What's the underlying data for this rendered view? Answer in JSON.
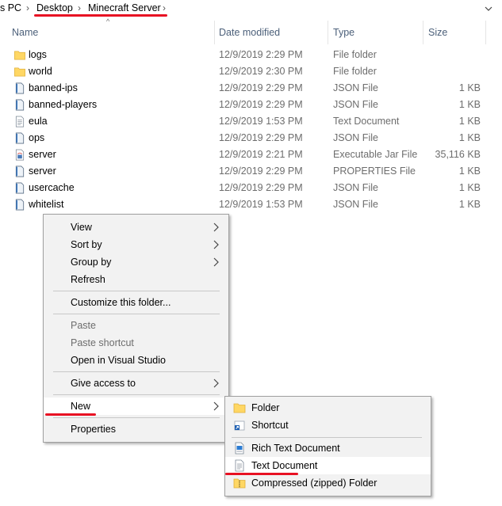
{
  "breadcrumb": {
    "pc": "s PC",
    "desktop": "Desktop",
    "folder": "Minecraft Server"
  },
  "columns": {
    "name": "Name",
    "date": "Date modified",
    "type": "Type",
    "size": "Size"
  },
  "files": [
    {
      "name": "logs",
      "date": "12/9/2019 2:29 PM",
      "type": "File folder",
      "size": "",
      "icon": "folder-icon"
    },
    {
      "name": "world",
      "date": "12/9/2019 2:30 PM",
      "type": "File folder",
      "size": "",
      "icon": "folder-icon"
    },
    {
      "name": "banned-ips",
      "date": "12/9/2019 2:29 PM",
      "type": "JSON File",
      "size": "1 KB",
      "icon": "json-file-icon"
    },
    {
      "name": "banned-players",
      "date": "12/9/2019 2:29 PM",
      "type": "JSON File",
      "size": "1 KB",
      "icon": "json-file-icon"
    },
    {
      "name": "eula",
      "date": "12/9/2019 1:53 PM",
      "type": "Text Document",
      "size": "1 KB",
      "icon": "text-file-icon"
    },
    {
      "name": "ops",
      "date": "12/9/2019 2:29 PM",
      "type": "JSON File",
      "size": "1 KB",
      "icon": "json-file-icon"
    },
    {
      "name": "server",
      "date": "12/9/2019 2:21 PM",
      "type": "Executable Jar File",
      "size": "35,116 KB",
      "icon": "jar-file-icon"
    },
    {
      "name": "server",
      "date": "12/9/2019 2:29 PM",
      "type": "PROPERTIES File",
      "size": "1 KB",
      "icon": "json-file-icon"
    },
    {
      "name": "usercache",
      "date": "12/9/2019 2:29 PM",
      "type": "JSON File",
      "size": "1 KB",
      "icon": "json-file-icon"
    },
    {
      "name": "whitelist",
      "date": "12/9/2019 1:53 PM",
      "type": "JSON File",
      "size": "1 KB",
      "icon": "json-file-icon"
    }
  ],
  "context_menu": {
    "view": "View",
    "sort_by": "Sort by",
    "group_by": "Group by",
    "refresh": "Refresh",
    "customize": "Customize this folder...",
    "paste": "Paste",
    "paste_shortcut": "Paste shortcut",
    "open_vs": "Open in Visual Studio",
    "give_access": "Give access to",
    "new": "New",
    "properties": "Properties"
  },
  "new_submenu": {
    "folder": "Folder",
    "shortcut": "Shortcut",
    "rich_text": "Rich Text Document",
    "text_doc": "Text Document",
    "zip_folder": "Compressed (zipped) Folder"
  },
  "colors": {
    "annotation_red": "#e81123",
    "folder_yellow": "#ffd764",
    "header_text": "#4c607a"
  }
}
